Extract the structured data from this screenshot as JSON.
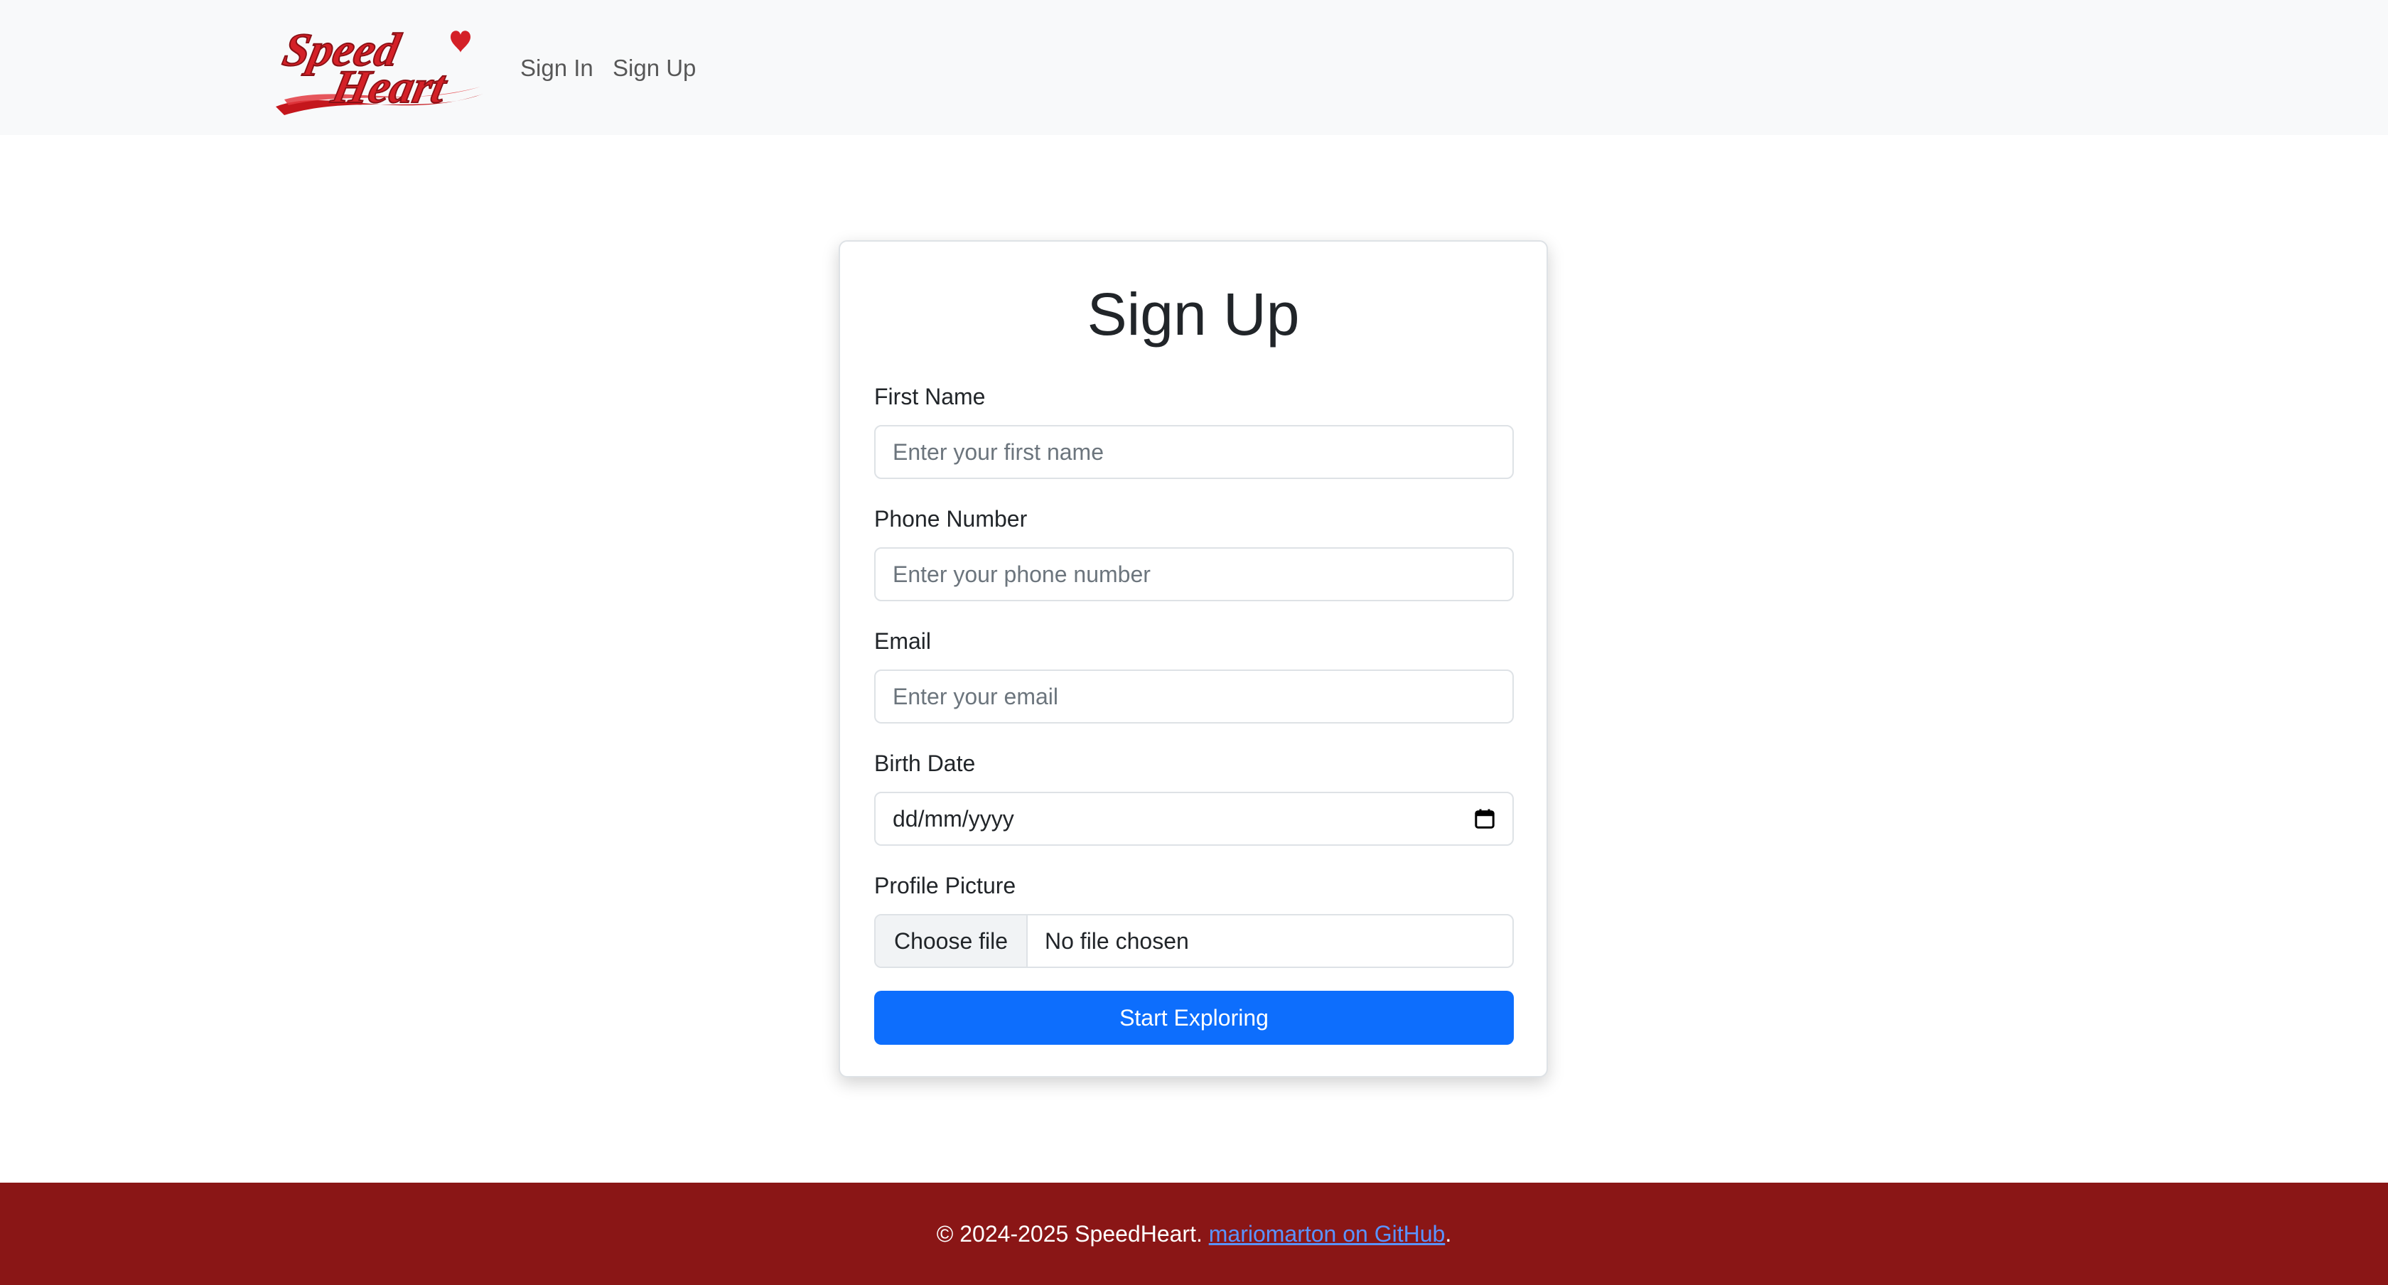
{
  "navbar": {
    "brand_name": "SpeedHeart",
    "links": {
      "sign_in": "Sign In",
      "sign_up": "Sign Up"
    }
  },
  "form": {
    "title": "Sign Up",
    "fields": {
      "first_name": {
        "label": "First Name",
        "placeholder": "Enter your first name",
        "value": ""
      },
      "phone_number": {
        "label": "Phone Number",
        "placeholder": "Enter your phone number",
        "value": ""
      },
      "email": {
        "label": "Email",
        "placeholder": "Enter your email",
        "value": ""
      },
      "birth_date": {
        "label": "Birth Date",
        "display": "dd/mm/yyyy",
        "icon": "calendar-icon"
      },
      "profile_picture": {
        "label": "Profile Picture",
        "button_label": "Choose file",
        "status": "No file chosen"
      }
    },
    "submit_label": "Start Exploring"
  },
  "footer": {
    "copyright": "© 2024-2025 SpeedHeart.",
    "link_text": "mariomarton on GitHub",
    "trailing": "."
  },
  "colors": {
    "navbar_bg": "#f8f9fa",
    "brand_red": "#d42027",
    "primary": "#0d6efd",
    "footer_bg": "#8a1616",
    "footer_link": "#5a93ff"
  }
}
